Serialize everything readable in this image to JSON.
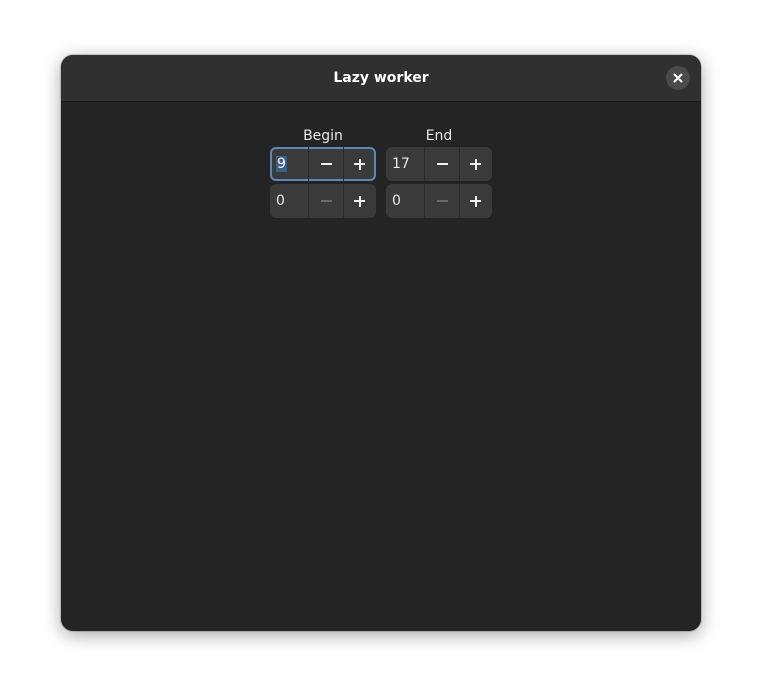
{
  "window": {
    "title": "Lazy worker",
    "close_icon": "close-icon"
  },
  "begin": {
    "label": "Begin",
    "hour": "9",
    "minute": "0"
  },
  "end": {
    "label": "End",
    "hour": "17",
    "minute": "0"
  },
  "icons": {
    "minus": "minus-icon",
    "plus": "plus-icon"
  },
  "colors": {
    "window_bg": "#242424",
    "headerbar_bg": "#303030",
    "focus_ring": "#5b89b4",
    "selection": "#3b5f86"
  }
}
